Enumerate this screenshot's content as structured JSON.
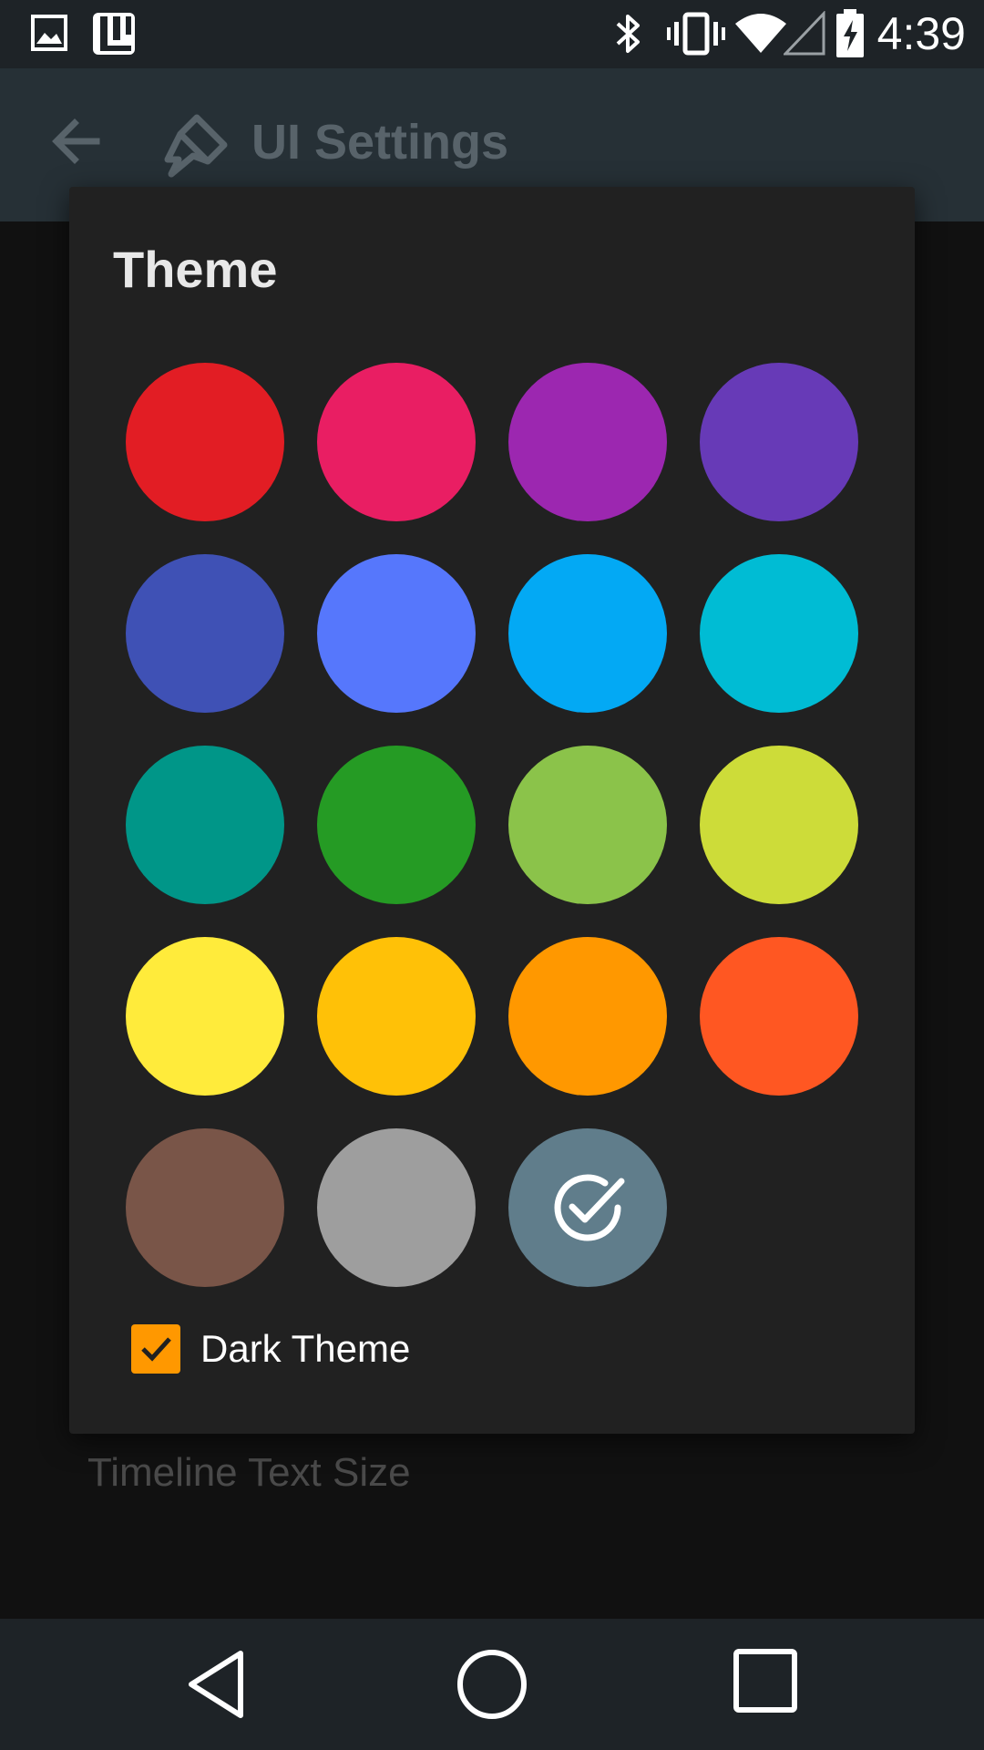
{
  "status_bar": {
    "time": "4:39",
    "icons": [
      "image-icon",
      "app-icon",
      "bluetooth-icon",
      "vibrate-icon",
      "wifi-icon",
      "signal-icon",
      "battery-charging-icon"
    ]
  },
  "app_bar": {
    "title": "UI Settings",
    "icons": [
      "back-arrow-icon",
      "brush-icon"
    ]
  },
  "background": {
    "items": [
      {
        "label": "Timeline Text Size"
      }
    ]
  },
  "dialog": {
    "title": "Theme",
    "swatches": [
      {
        "name": "red",
        "color": "#e21d24",
        "selected": false
      },
      {
        "name": "pink",
        "color": "#e91e63",
        "selected": false
      },
      {
        "name": "purple",
        "color": "#9c27b0",
        "selected": false
      },
      {
        "name": "deep-purple",
        "color": "#673ab7",
        "selected": false
      },
      {
        "name": "indigo",
        "color": "#3f51b5",
        "selected": false
      },
      {
        "name": "blue",
        "color": "#5677fc",
        "selected": false
      },
      {
        "name": "light-blue",
        "color": "#03a9f4",
        "selected": false
      },
      {
        "name": "cyan",
        "color": "#00bcd4",
        "selected": false
      },
      {
        "name": "teal",
        "color": "#009688",
        "selected": false
      },
      {
        "name": "green",
        "color": "#259b24",
        "selected": false
      },
      {
        "name": "light-green",
        "color": "#8bc34a",
        "selected": false
      },
      {
        "name": "lime",
        "color": "#cddc39",
        "selected": false
      },
      {
        "name": "yellow",
        "color": "#ffeb3b",
        "selected": false
      },
      {
        "name": "amber",
        "color": "#ffc107",
        "selected": false
      },
      {
        "name": "orange",
        "color": "#ff9800",
        "selected": false
      },
      {
        "name": "deep-orange",
        "color": "#ff5722",
        "selected": false
      },
      {
        "name": "brown",
        "color": "#795548",
        "selected": false
      },
      {
        "name": "grey",
        "color": "#9e9e9e",
        "selected": false
      },
      {
        "name": "blue-grey",
        "color": "#607d8b",
        "selected": true
      }
    ],
    "dark_theme": {
      "label": "Dark Theme",
      "checked": true,
      "accent": "#ff9800"
    }
  },
  "nav_bar": {
    "buttons": [
      "back-triangle-icon",
      "home-circle-icon",
      "recents-square-icon"
    ]
  }
}
